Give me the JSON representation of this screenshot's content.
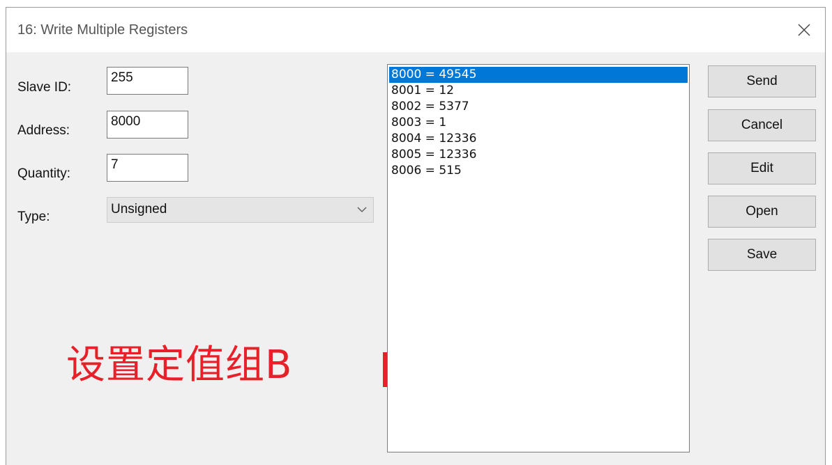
{
  "window": {
    "title": "16: Write Multiple Registers",
    "close_icon": "close-icon"
  },
  "form": {
    "slave_id_label": "Slave ID:",
    "slave_id_value": "255",
    "address_label": "Address:",
    "address_value": "8000",
    "quantity_label": "Quantity:",
    "quantity_value": "7",
    "type_label": "Type:",
    "type_value": "Unsigned",
    "type_dropdown_icon": "chevron-down-icon"
  },
  "registers": {
    "selected_index": 0,
    "items": [
      "8000 = 49545",
      "8001 = 12",
      "8002 = 5377",
      "8003 = 1",
      "8004 = 12336",
      "8005 = 12336",
      "8006 = 515"
    ]
  },
  "buttons": {
    "send": "Send",
    "cancel": "Cancel",
    "edit": "Edit",
    "open": "Open",
    "save": "Save"
  },
  "annotation": {
    "text": "设置定值组B",
    "color": "#e8202a"
  },
  "colors": {
    "selection": "#0078d7",
    "dialog_bg": "#f0f0f0"
  }
}
